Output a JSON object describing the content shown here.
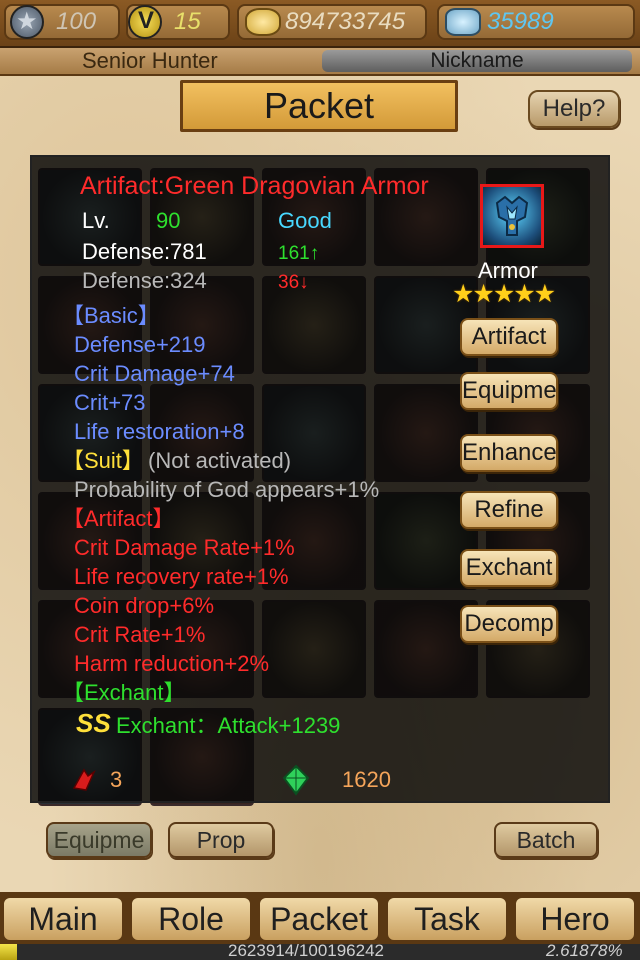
{
  "resources": {
    "star": "100",
    "vip": "15",
    "gold": "894733745",
    "diamond": "35989"
  },
  "player": {
    "rank": "Senior Hunter",
    "nickname": "Nickname"
  },
  "header": {
    "title": "Packet",
    "help_label": "Help?"
  },
  "item": {
    "name": "Artifact:Green Dragovian Armor",
    "level_label": "Lv.",
    "level": "90",
    "quality": "Good",
    "defense": "Defense:781",
    "defense_up": "161↑",
    "compare_defense": "Defense:324",
    "compare_down": "36↓",
    "type": "Armor",
    "stars": 5,
    "stars_text": "★★★★★",
    "icon": "armor-icon",
    "basic_header": "【Basic】",
    "basic": [
      "Defense+219",
      "Crit Damage+74",
      "Crit+73",
      "Life restoration+8"
    ],
    "suit_header": "【Suit】",
    "suit_status": "(Not activated)",
    "suit_effect": "Probability of God appears+1%",
    "artifact_header": "【Artifact】",
    "artifact": [
      "Crit Damage Rate+1%",
      "Life recovery rate+1%",
      "Coin drop+6%",
      "Crit Rate+1%",
      "Harm reduction+2%"
    ],
    "exchant_header": "【Exchant】",
    "exchant_grade": "SS",
    "exchant_value": "Exchant：Attack+1239",
    "cost_shard": "3",
    "cost_crystal": "1620"
  },
  "actions": [
    "Artifact",
    "Equipme",
    "Enhance",
    "Refine",
    "Exchant",
    "Decomp"
  ],
  "tabs": {
    "equipment": "Equipme",
    "prop": "Prop",
    "batch": "Batch"
  },
  "nav": [
    "Main",
    "Role",
    "Packet",
    "Task",
    "Hero"
  ],
  "exp": {
    "text": "2623914/100196242",
    "percent": "2.61878%",
    "fraction": 0.0262
  },
  "colors": {
    "item_name": "#ff2b2b",
    "basic": "#6b8cff",
    "exchant": "#2ee02e",
    "quality": "#48d8ff",
    "stars": "#ffcf1a"
  }
}
